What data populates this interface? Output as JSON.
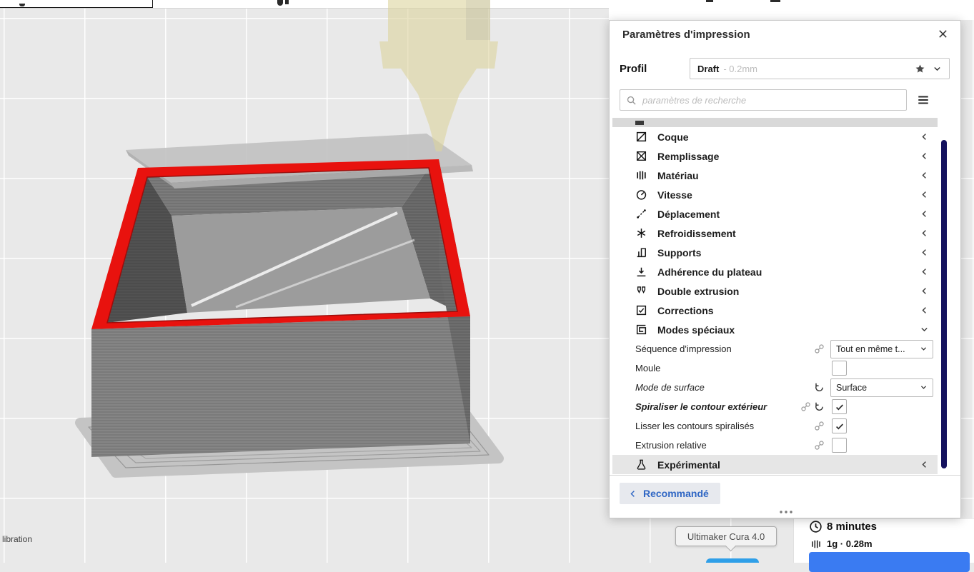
{
  "colors": {
    "accent_blue": "#2f66c4",
    "cura_button_blue": "#3a7bf2",
    "rim_red": "#e8120e",
    "scrollbar_navy": "#15125e",
    "sliver_blue": "#2f9fe8"
  },
  "viewport": {
    "partial_text": "libration"
  },
  "tooltip": {
    "text": "Ultimaker Cura 4.0"
  },
  "settings_panel": {
    "title": "Paramètres d'impression",
    "profile": {
      "label": "Profil",
      "name": "Draft",
      "variant": "- 0.2mm"
    },
    "search": {
      "placeholder": "paramètres de recherche"
    },
    "rows": [
      {
        "kind": "partial-category"
      },
      {
        "kind": "category",
        "icon": "shell",
        "label": "Coque",
        "state": "collapsed"
      },
      {
        "kind": "category",
        "icon": "infill",
        "label": "Remplissage",
        "state": "collapsed"
      },
      {
        "kind": "category",
        "icon": "material",
        "label": "Matériau",
        "state": "collapsed"
      },
      {
        "kind": "category",
        "icon": "speed",
        "label": "Vitesse",
        "state": "collapsed"
      },
      {
        "kind": "category",
        "icon": "travel",
        "label": "Déplacement",
        "state": "collapsed"
      },
      {
        "kind": "category",
        "icon": "cooling",
        "label": "Refroidissement",
        "state": "collapsed"
      },
      {
        "kind": "category",
        "icon": "support",
        "label": "Supports",
        "state": "collapsed"
      },
      {
        "kind": "category",
        "icon": "adhesion",
        "label": "Adhérence du plateau",
        "state": "collapsed"
      },
      {
        "kind": "category",
        "icon": "dual-extrusion",
        "label": "Double extrusion",
        "state": "collapsed"
      },
      {
        "kind": "category",
        "icon": "corrections",
        "label": "Corrections",
        "state": "collapsed"
      },
      {
        "kind": "category",
        "icon": "special-modes",
        "label": "Modes spéciaux",
        "state": "expanded"
      },
      {
        "kind": "setting",
        "label": "Séquence d'impression",
        "icons": [
          "link"
        ],
        "control": {
          "type": "dropdown",
          "value": "Tout en même t..."
        }
      },
      {
        "kind": "setting",
        "label": "Moule",
        "icons": [],
        "control": {
          "type": "checkbox",
          "checked": false
        }
      },
      {
        "kind": "setting",
        "label": "Mode de surface",
        "italic": true,
        "icons": [
          "revert"
        ],
        "control": {
          "type": "dropdown",
          "value": "Surface"
        }
      },
      {
        "kind": "setting",
        "label": "Spiraliser le contour extérieur",
        "italic": true,
        "bold": true,
        "icons": [
          "link",
          "revert"
        ],
        "control": {
          "type": "checkbox",
          "checked": true
        }
      },
      {
        "kind": "setting",
        "label": "Lisser les contours spiralisés",
        "icons": [
          "link"
        ],
        "control": {
          "type": "checkbox",
          "checked": true
        }
      },
      {
        "kind": "setting",
        "label": "Extrusion relative",
        "icons": [
          "link"
        ],
        "control": {
          "type": "checkbox",
          "checked": false
        }
      },
      {
        "kind": "category",
        "icon": "experimental",
        "label": "Expérimental",
        "state": "collapsed",
        "highlighted": true
      }
    ],
    "footer": {
      "back_label": "Recommandé"
    }
  },
  "action_panel": {
    "time": "8 minutes",
    "material": "1g · 0.28m"
  }
}
